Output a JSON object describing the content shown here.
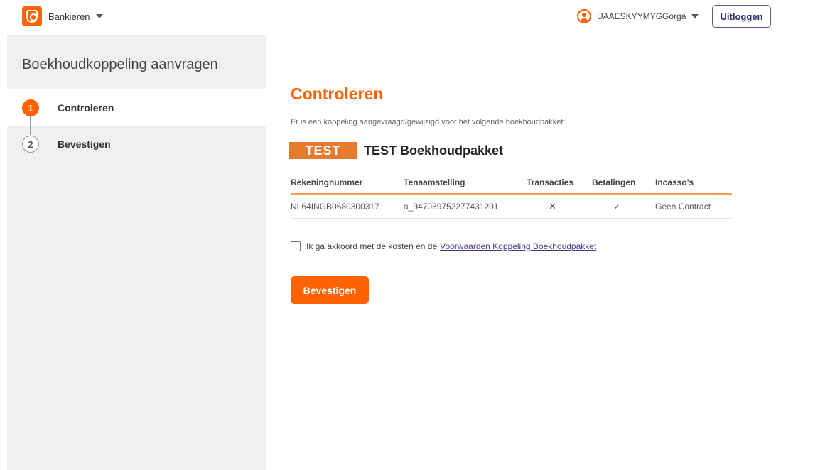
{
  "header": {
    "brand_label": "Bankieren",
    "user_name": "UAAESKYYMYGGorga",
    "logout_label": "Uitloggen",
    "brand_color": "#ff6200"
  },
  "sidebar": {
    "title": "Boekhoudkoppeling aanvragen",
    "steps": [
      {
        "number": "1",
        "label": "Controleren",
        "active": true
      },
      {
        "number": "2",
        "label": "Bevestigen",
        "active": false
      }
    ]
  },
  "main": {
    "title": "Controleren",
    "intro": "Er is een koppeling aangevraagd/gewijzigd voor het volgende boekhoudpakket:",
    "package_badge": "TEST",
    "package_name": "TEST Boekhoudpakket",
    "table": {
      "headers": [
        "Rekeningnummer",
        "Tenaamstelling",
        "Transacties",
        "Betalingen",
        "Incasso's"
      ],
      "rows": [
        {
          "account": "NL64INGB0680300317",
          "holder": "a_947039752277431201",
          "transacties": "✕",
          "betalingen": "✓",
          "incassos": "Geen Contract"
        }
      ]
    },
    "agree_text": "Ik ga akkoord met de kosten en de",
    "agree_link": "Voorwaarden Koppeling Boekhoudpakket",
    "confirm_label": "Bevestigen"
  }
}
